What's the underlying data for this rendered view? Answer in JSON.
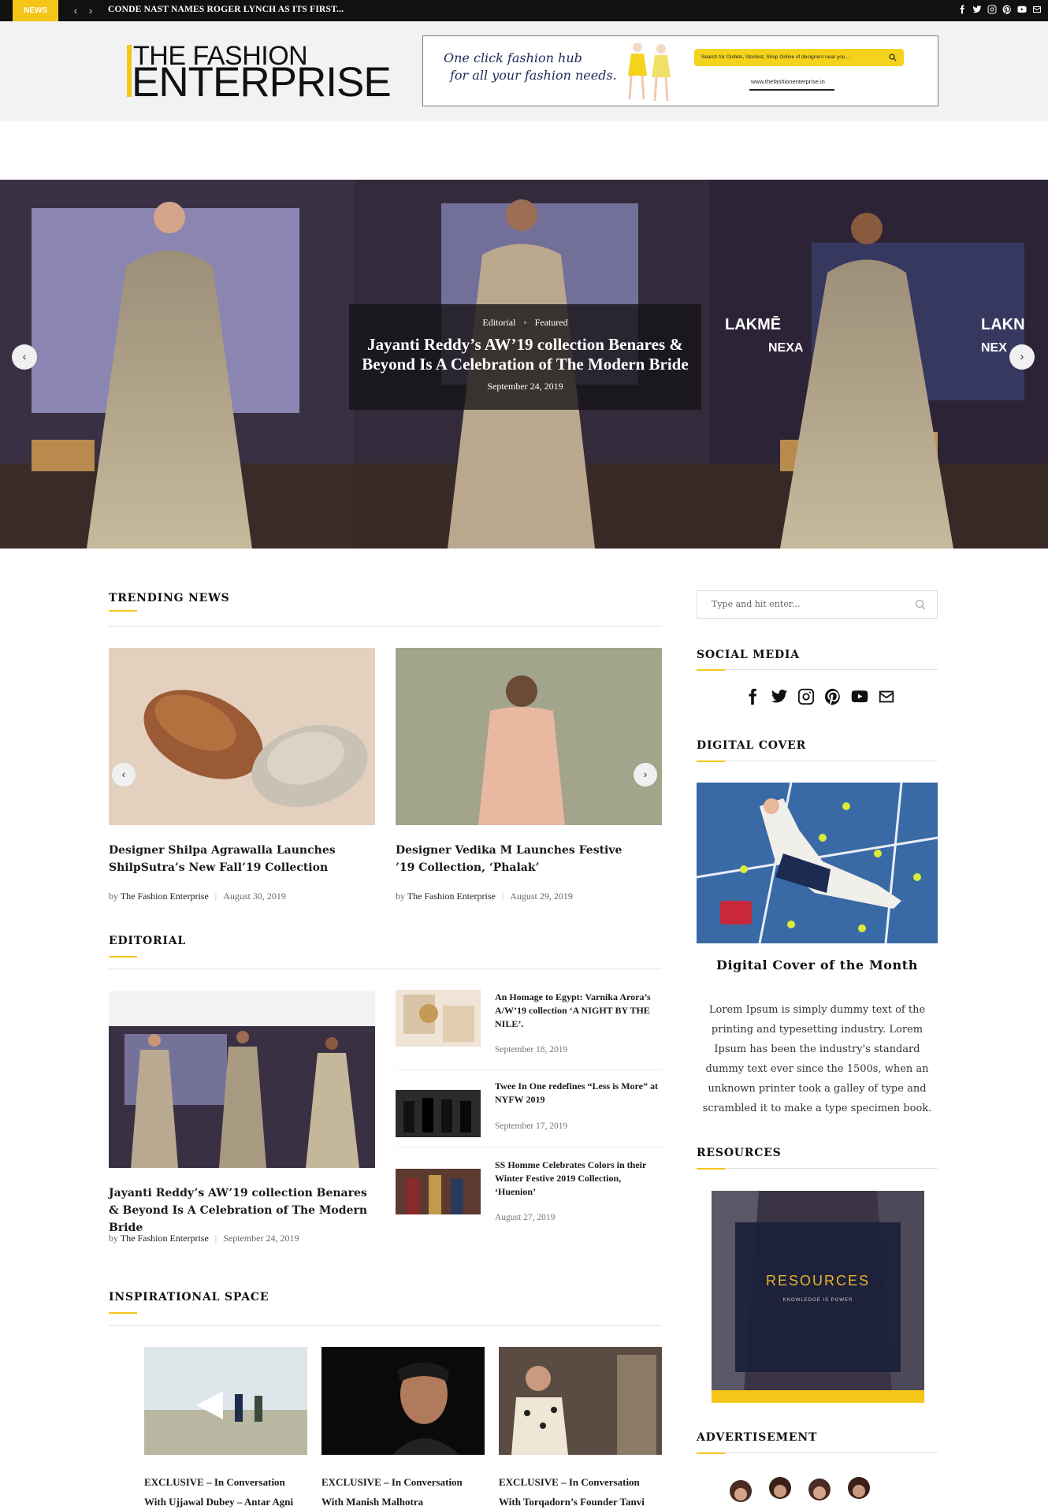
{
  "topbar": {
    "news_tag": "NEWS",
    "prev": "‹",
    "next": "›",
    "ticker": "CONDE NAST NAMES ROGER LYNCH AS ITS FIRST...",
    "social_icons": [
      "facebook-icon",
      "twitter-icon",
      "instagram-icon",
      "pinterest-icon",
      "youtube-icon",
      "envelope-icon"
    ]
  },
  "header": {
    "logo_line1": "THE FASHION",
    "logo_line2": "ENTERPRISE",
    "banner": {
      "tagline1": "One click fashion hub",
      "tagline2": "for all your fashion needs.",
      "search_placeholder": "Search for Outlets, Stockist, Shop Online of designers near you....",
      "url": "www.thefashionenterprise.in"
    }
  },
  "hero": {
    "categories": [
      "Editorial",
      "Featured"
    ],
    "separator": "◦",
    "title": "Jayanti Reddy’s AW’19 collection Benares & Beyond Is A Celebration of The Modern Bride",
    "date": "September 24, 2019",
    "prev": "‹",
    "next": "›"
  },
  "trending": {
    "heading": "TRENDING NEWS",
    "prev": "‹",
    "next": "›",
    "articles": [
      {
        "title": "Designer Shilpa Agrawalla Launches ShilpSutra’s New Fall’19 Collection",
        "by": "by",
        "author": "The Fashion Enterprise",
        "date": "August 30, 2019"
      },
      {
        "title": "Designer Vedika M Launches Festive ’19 Collection, ‘Phalak’",
        "by": "by",
        "author": "The Fashion Enterprise",
        "date": "August 29, 2019"
      }
    ]
  },
  "editorial": {
    "heading": "EDITORIAL",
    "main": {
      "title": "Jayanti Reddy’s AW’19 collection Benares & Beyond Is A Celebration of The Modern Bride",
      "by": "by",
      "author": "The Fashion Enterprise",
      "date": "September 24, 2019"
    },
    "list": [
      {
        "title": "An Homage to Egypt: Varnika Arora’s A/W’19 collection ‘A NIGHT BY THE NILE’.",
        "date": "September 18, 2019"
      },
      {
        "title": "Twee In One redefines “Less is More” at NYFW 2019",
        "date": "September 17, 2019"
      },
      {
        "title": "SS Homme Celebrates Colors in their Winter Festive 2019 Collection, ‘Huenion’",
        "date": "August 27, 2019"
      }
    ]
  },
  "inspirational": {
    "heading": "INSPIRATIONAL SPACE",
    "items": [
      {
        "line1": "EXCLUSIVE – In Conversation",
        "line2": "With Ujjawal Dubey – Antar Agni"
      },
      {
        "line1": "EXCLUSIVE – In Conversation",
        "line2": "With Manish Malhotra"
      },
      {
        "line1": "EXCLUSIVE – In Conversation",
        "line2": "With Torqadorn’s Founder Tanvi"
      }
    ]
  },
  "sidebar": {
    "search_placeholder": "Type and hit enter...",
    "social_heading": "SOCIAL MEDIA",
    "social_icons": [
      "facebook-icon",
      "twitter-icon",
      "instagram-icon",
      "pinterest-icon",
      "youtube-icon",
      "envelope-icon"
    ],
    "cover_heading": "DIGITAL COVER",
    "cover_title": "Digital Cover of the Month",
    "cover_text": "Lorem Ipsum is simply dummy text of the printing and typesetting industry. Lorem Ipsum has been the industry's standard dummy text ever since the 1500s, when an unknown printer took a galley of type and scrambled it to make a type specimen book.",
    "resources_heading": "RESOURCES",
    "resources_title": "RESOURCES",
    "resources_sub": "KNOWLEDGE IS POWER",
    "ad_heading": "ADVERTISEMENT"
  },
  "colors": {
    "accent": "#f5c518",
    "topbar": "#111111",
    "header_bg": "#f1f2f2"
  }
}
